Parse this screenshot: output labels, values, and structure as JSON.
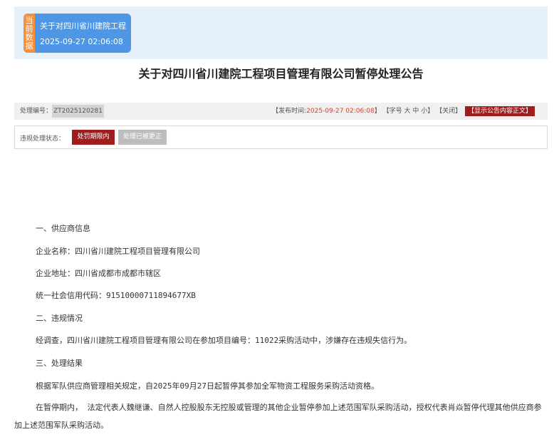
{
  "banner": {
    "tag": "当前数据",
    "title": "关于对四川省川建院工程",
    "time": "2025-09-27 02:06:08"
  },
  "page_title": "关于对四川省川建院工程项目管理有限公司暂停处理公告",
  "meta": {
    "id_label": "处理编号：",
    "id_value": "ZT2025120281",
    "publish_label": "【发布时间:",
    "publish_time": "2025-09-27 02:06:08",
    "publish_close": "】",
    "font_size": "【字号 大 中 小】",
    "close": "【关闭】",
    "show_text": "【显示公告内容正文】"
  },
  "status": {
    "label": "违规处理状态：",
    "active": "处罚期限内",
    "inactive": "处理已被更正"
  },
  "content": {
    "s1_title": "一、供应商信息",
    "company_name": "企业名称：四川省川建院工程项目管理有限公司",
    "company_address": "企业地址：四川省成都市成都市辖区",
    "credit_code": "统一社会信用代码：91510000711894677XB",
    "s2_title": "二、违规情况",
    "violation": "经调查，四川省川建院工程项目管理有限公司在参加项目编号：11022采购活动中，涉嫌存在违规失信行为。",
    "s3_title": "三、处理结果",
    "result1": "根据军队供应商管理相关规定，自2025年09月27日起暂停其参加全军物资工程服务采购活动资格。",
    "result2": "在暂停期内， 法定代表人魏继谦、自然人控股股东无控股或管理的其他企业暂停参加上述范围军队采购活动，授权代表肖焱暂停代理其他供应商参加上述范围军队采购活动。"
  }
}
